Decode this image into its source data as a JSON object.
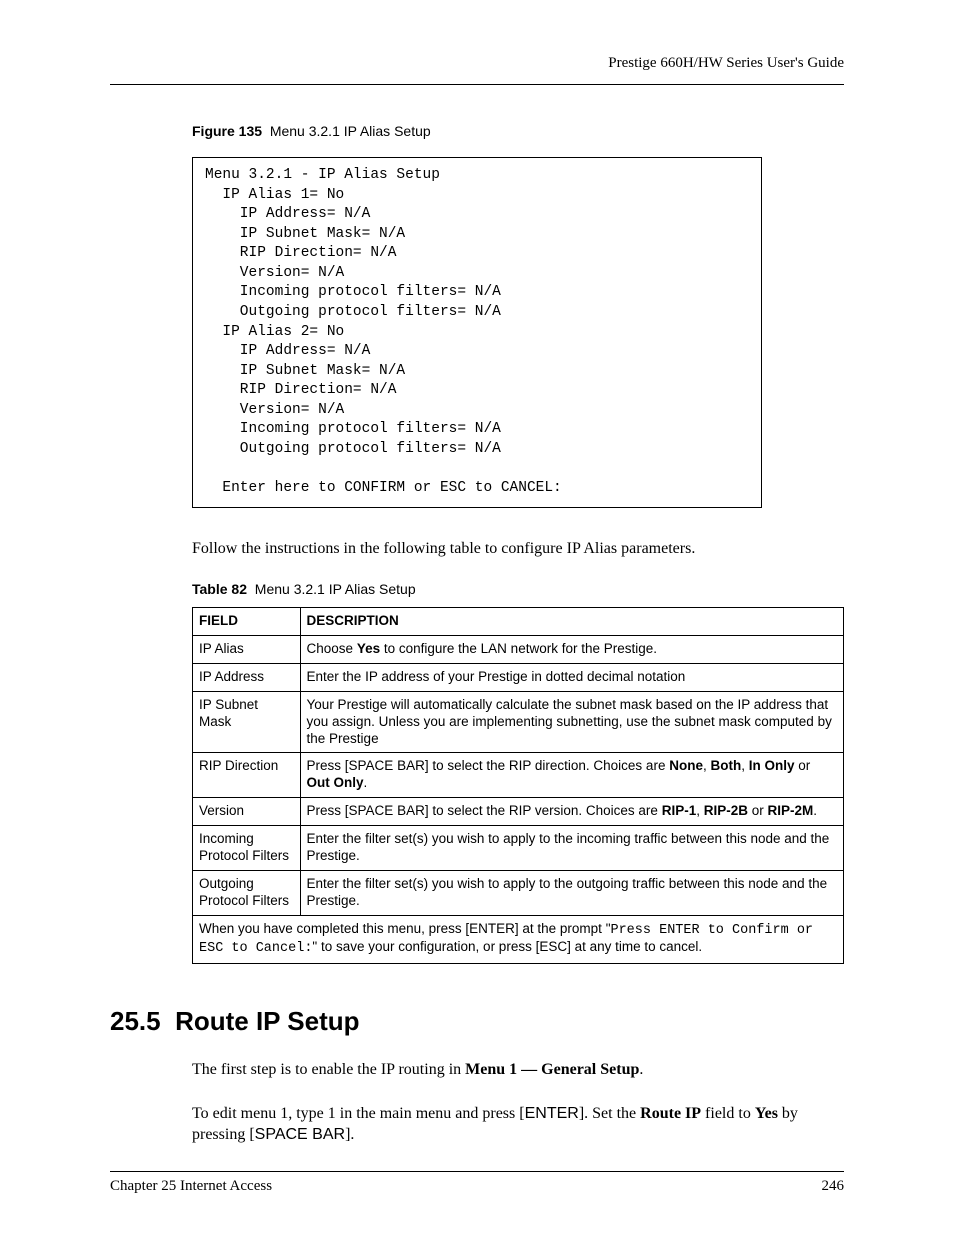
{
  "header": {
    "right_text": "Prestige 660H/HW Series User's Guide"
  },
  "figure": {
    "label": "Figure 135",
    "title": "Menu 3.2.1 IP Alias Setup",
    "terminal": "Menu 3.2.1 - IP Alias Setup\n  IP Alias 1= No\n    IP Address= N/A\n    IP Subnet Mask= N/A\n    RIP Direction= N/A\n    Version= N/A\n    Incoming protocol filters= N/A\n    Outgoing protocol filters= N/A\n  IP Alias 2= No\n    IP Address= N/A\n    IP Subnet Mask= N/A\n    RIP Direction= N/A\n    Version= N/A\n    Incoming protocol filters= N/A\n    Outgoing protocol filters= N/A\n\n  Enter here to CONFIRM or ESC to CANCEL:"
  },
  "intro_para": "Follow the instructions in the following table to configure IP Alias parameters.",
  "table": {
    "label": "Table 82",
    "title": "Menu 3.2.1 IP Alias Setup",
    "headers": {
      "c1": "FIELD",
      "c2": "DESCRIPTION"
    },
    "rows": [
      {
        "field": "IP Alias",
        "desc_prefix": "Choose ",
        "desc_bold1": "Yes",
        "desc_suffix": " to configure the LAN network for the Prestige."
      },
      {
        "field": "IP Address",
        "desc": "Enter the IP address of your Prestige in dotted decimal notation"
      },
      {
        "field": "IP Subnet Mask",
        "desc": "Your Prestige will automatically calculate the subnet mask based on the IP address that you assign. Unless you are implementing subnetting, use the subnet mask computed by the Prestige"
      },
      {
        "field": "RIP Direction",
        "p1": "Press [",
        "sans1": "SPACE BAR",
        "p2": "] to select the RIP direction.  Choices are ",
        "b1": "None",
        "c1": ", ",
        "b2": "Both",
        "c2": ", ",
        "b3": "In Only",
        "p3": " or ",
        "b4": "Out Only",
        "p4": "."
      },
      {
        "field": "Version",
        "p1": "Press [",
        "sans1": "SPACE BAR",
        "p2": "] to select the RIP version. Choices are ",
        "b1": "RIP-1",
        "c1": ", ",
        "b2": "RIP-2B",
        "c2": " or ",
        "b3": "RIP-2M",
        "p3": "."
      },
      {
        "field": "Incoming Protocol Filters",
        "desc": "Enter the filter set(s) you wish to apply to the incoming traffic between this node and the Prestige."
      },
      {
        "field": "Outgoing Protocol Filters",
        "desc": "Enter the filter set(s) you wish to apply to the outgoing traffic between this node and the Prestige."
      }
    ],
    "footnote": {
      "p1": "When you have completed this menu, press [ENTER] at the prompt \"",
      "mono1": "Press ENTER to Confirm or ESC to Cancel:",
      "p2": "\" to save your configuration, or press [ESC] at any time to cancel."
    }
  },
  "section": {
    "number": "25.5",
    "title": "Route IP Setup",
    "para1_prefix": "The first step is to enable the IP routing in ",
    "para1_bold": "Menu 1 — General Setup",
    "para1_suffix": ".",
    "para2_p1": "To edit menu 1, type 1 in the main menu and press [",
    "para2_sans1": "ENTER",
    "para2_p2": "].  Set the ",
    "para2_b1": "Route IP",
    "para2_p3": " field to ",
    "para2_b2": "Yes",
    "para2_p4": " by pressing [",
    "para2_sans2": "SPACE BAR",
    "para2_p5": "]."
  },
  "footer": {
    "left": "Chapter 25 Internet Access",
    "right": "246"
  }
}
